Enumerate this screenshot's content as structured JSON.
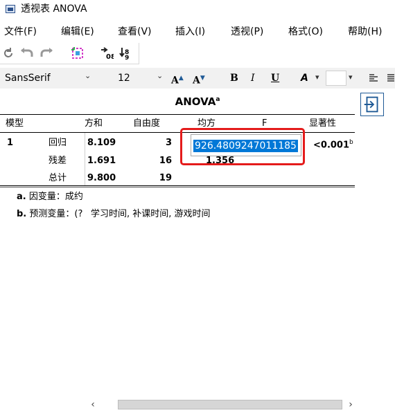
{
  "window": {
    "title": "透视表 ANOVA"
  },
  "menu": [
    {
      "label": "文件(F)"
    },
    {
      "label": "编辑(E)"
    },
    {
      "label": "查看(V)"
    },
    {
      "label": "插入(I)"
    },
    {
      "label": "透视(P)"
    },
    {
      "label": "格式(O)"
    },
    {
      "label": "帮助(H)"
    }
  ],
  "toolbar": {
    "icons": [
      "undo-icon",
      "back-icon",
      "forward-icon",
      "pivot-trays-icon",
      "swap-columns-icon",
      "swap-rows-icon"
    ]
  },
  "format_bar": {
    "font": "SansSerif",
    "size": "12",
    "bold": "B",
    "italic": "I",
    "underline": "U",
    "text_color": "A"
  },
  "table": {
    "title": "ANOVA",
    "title_sup": "a",
    "headers": {
      "model": "模型",
      "ss": "方和",
      "df": "自由度",
      "ms": "均方",
      "f": "F",
      "sig": "显著性"
    },
    "rows": [
      {
        "model": "1",
        "source": "回归",
        "ss": "8.109",
        "df": "3",
        "ms": "",
        "sig": "<0.001",
        "sig_sup": "b"
      },
      {
        "model": "",
        "source": "残差",
        "ss": "1.691",
        "df": "16",
        "ms": "1.356",
        "sig": "",
        "sig_sup": ""
      },
      {
        "model": "",
        "source": "总计",
        "ss": "9.800",
        "df": "19",
        "ms": "",
        "sig": "",
        "sig_sup": ""
      }
    ],
    "editing_value": "926.4809247011185",
    "footnotes": {
      "a_label": "a.",
      "a_text": "因变量：成约",
      "b_label": "b.",
      "b_text": "预测变量：(?",
      "b_text2": "学习时间, 补课时间, 游戏时间"
    }
  },
  "colors": {
    "selection": "#0078d7",
    "highlight_frame": "#e41b1b",
    "accent": "#1f5a96"
  }
}
